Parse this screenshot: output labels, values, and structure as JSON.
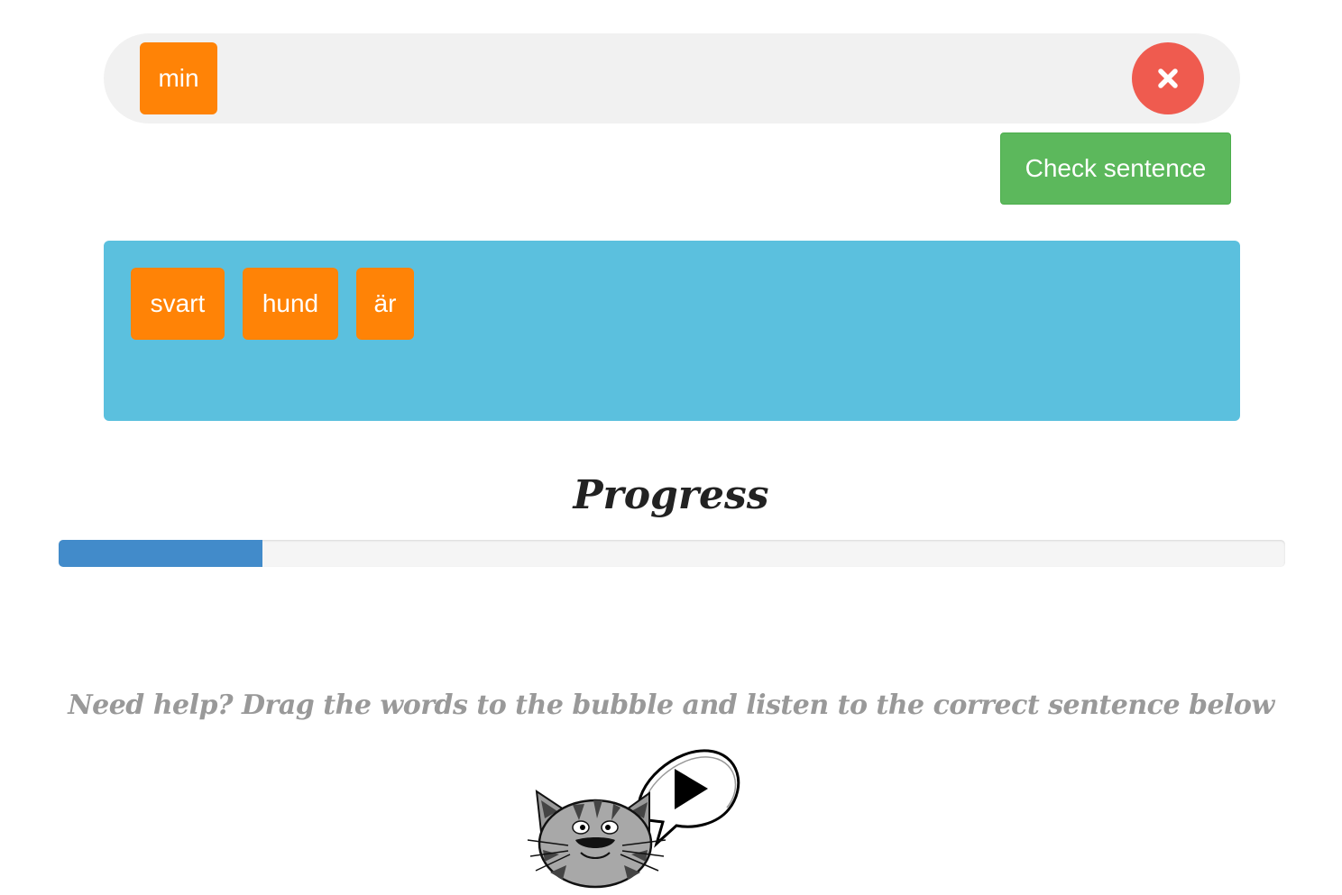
{
  "sentence_bar": {
    "placed_words": [
      "min"
    ],
    "clear_icon": "close-icon",
    "clear_color": "#ef5b4f"
  },
  "check_button": {
    "label": "Check sentence",
    "color": "#5cb85c"
  },
  "word_bank": {
    "words": [
      "svart",
      "hund",
      "är"
    ],
    "background": "#5bc0de",
    "chip_color": "#ff8306"
  },
  "progress": {
    "title": "Progress",
    "fraction": 0.166,
    "fill_color": "#428bca"
  },
  "help": {
    "text": "Need help? Drag the words to the bubble and listen to the correct sentence below",
    "audio_icon": "play-icon",
    "mascot": "cat-icon"
  }
}
